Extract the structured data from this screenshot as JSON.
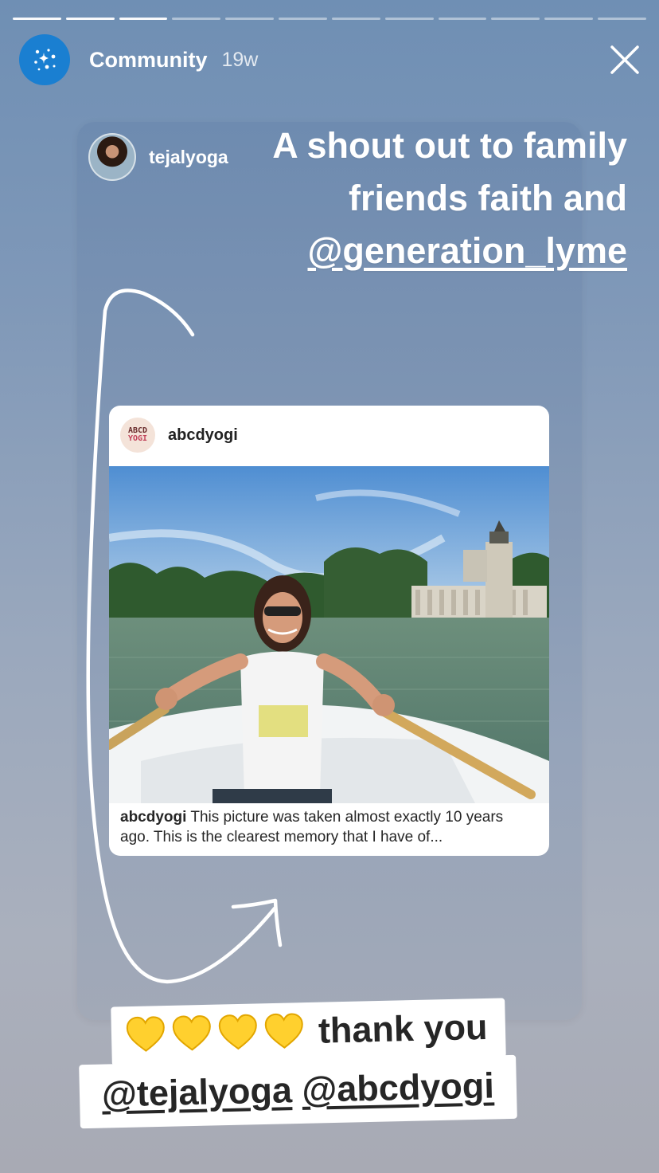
{
  "header": {
    "account_name": "Community",
    "time_ago": "19w",
    "avatar_icon": "sparkles-icon",
    "close_icon": "close-icon",
    "progress_segments": 12,
    "progress_done": 3
  },
  "shared_story": {
    "author": "tejalyoga",
    "text_line1": "A shout out to family",
    "text_line2": "friends faith and",
    "mention": "@generation_lyme"
  },
  "embedded_post": {
    "username": "abcdyogi",
    "avatar_line1": "ABCD",
    "avatar_line2": "YOGI",
    "caption_user": "abcdyogi",
    "caption_text": " This picture was taken almost exactly 10 years ago. This is the clearest memory that I have of..."
  },
  "sticker": {
    "hearts": [
      "yellow-heart-icon",
      "yellow-heart-icon",
      "yellow-heart-icon",
      "yellow-heart-icon"
    ],
    "thank_text": "thank you",
    "mention1": "@tejalyoga",
    "mention2": "@abcdyogi"
  },
  "colors": {
    "community_avatar": "#1a7fd1",
    "heart": "#ffd02e"
  }
}
